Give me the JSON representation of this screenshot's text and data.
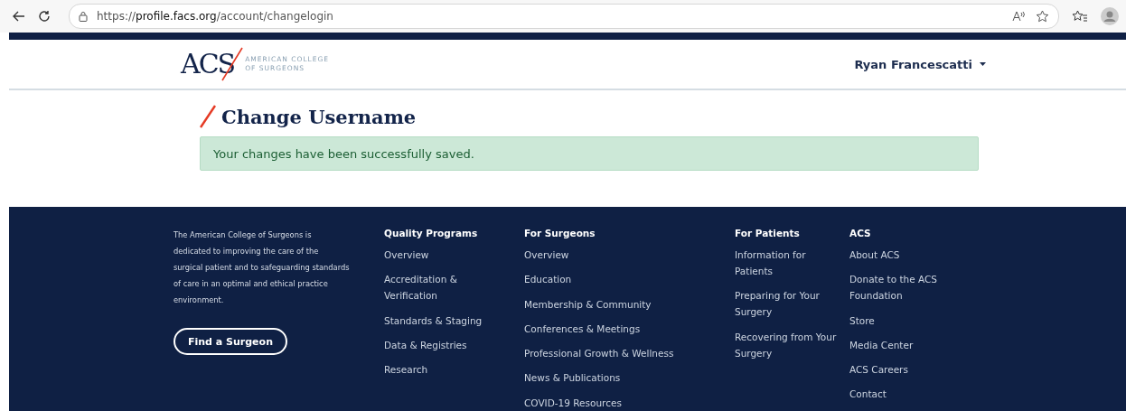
{
  "browser": {
    "url": "https://**profile.facs.org**/account/changelogin"
  },
  "header": {
    "logo": {
      "mark": "ACS",
      "line_1": "AMERICAN COLLEGE",
      "line_2": "OF SURGEONS"
    },
    "user_menu": "Ryan Francescatti"
  },
  "main": {
    "title": "Change Username",
    "alert": {
      "kind": "success",
      "text": "Your changes have been successfully saved."
    }
  },
  "footer": {
    "about": "The American College of Surgeons is dedicated to improving the care of the surgical patient and to safeguarding standards of care in an optimal and ethical practice environment.",
    "button": "Find a Surgeon",
    "columns": [
      {
        "heading": "Quality Programs",
        "links": [
          "Overview",
          "Accreditation & Verification",
          "Standards & Staging",
          "Data & Registries",
          "Research"
        ]
      },
      {
        "heading": "For Surgeons",
        "links": [
          "Overview",
          "Education",
          "Membership & Community",
          "Conferences & Meetings",
          "Professional Growth & Wellness",
          "News & Publications",
          "COVID-19 Resources"
        ]
      },
      {
        "heading": "For Patients",
        "links": [
          "Information for Patients",
          "Preparing for Your Surgery",
          "Recovering from Your Surgery"
        ]
      },
      {
        "heading": "ACS",
        "links": [
          "About ACS",
          "Donate to the ACS Foundation",
          "Store",
          "Media Center",
          "ACS Careers",
          "Contact"
        ]
      }
    ]
  }
}
